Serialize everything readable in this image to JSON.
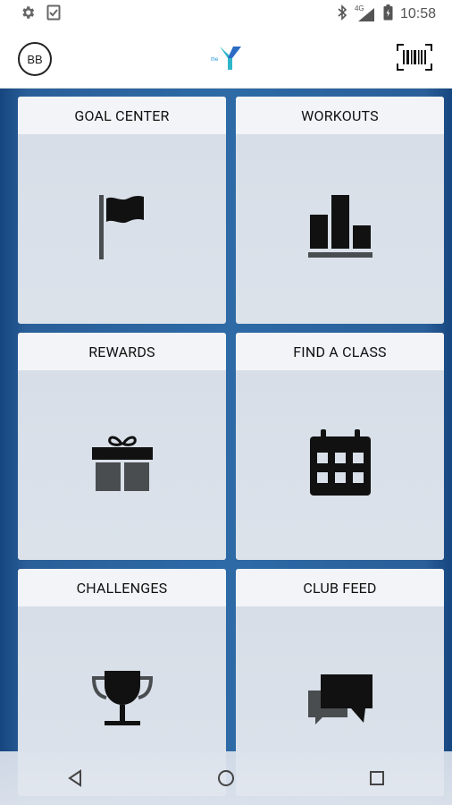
{
  "status_bar": {
    "left_icons": [
      "settings-icon",
      "clipboard-check-icon"
    ],
    "right_icons": [
      "bluetooth-icon",
      "signal-4g-icon",
      "battery-icon"
    ],
    "network_label": "4G",
    "time": "10:58"
  },
  "app_bar": {
    "avatar_initials": "BB",
    "logo_prefix": "the",
    "logo_icon": "ymca-y-icon",
    "barcode_icon": "barcode-scan-icon"
  },
  "tiles": [
    {
      "title": "GOAL CENTER",
      "icon": "flag-icon"
    },
    {
      "title": "WORKOUTS",
      "icon": "bar-chart-icon"
    },
    {
      "title": "REWARDS",
      "icon": "gift-icon"
    },
    {
      "title": "FIND A CLASS",
      "icon": "calendar-icon"
    },
    {
      "title": "CHALLENGES",
      "icon": "trophy-icon"
    },
    {
      "title": "CLUB FEED",
      "icon": "chat-bubbles-icon"
    }
  ],
  "nav_bar": {
    "buttons": [
      "back-icon",
      "home-icon",
      "recents-icon"
    ]
  },
  "colors": {
    "background_blue": "#2d6aa6",
    "tile_header": "#f2f4f7",
    "tile_body": "#d9e0e9",
    "logo_teal": "#2fb6c9",
    "logo_blue": "#2b6cc4"
  }
}
